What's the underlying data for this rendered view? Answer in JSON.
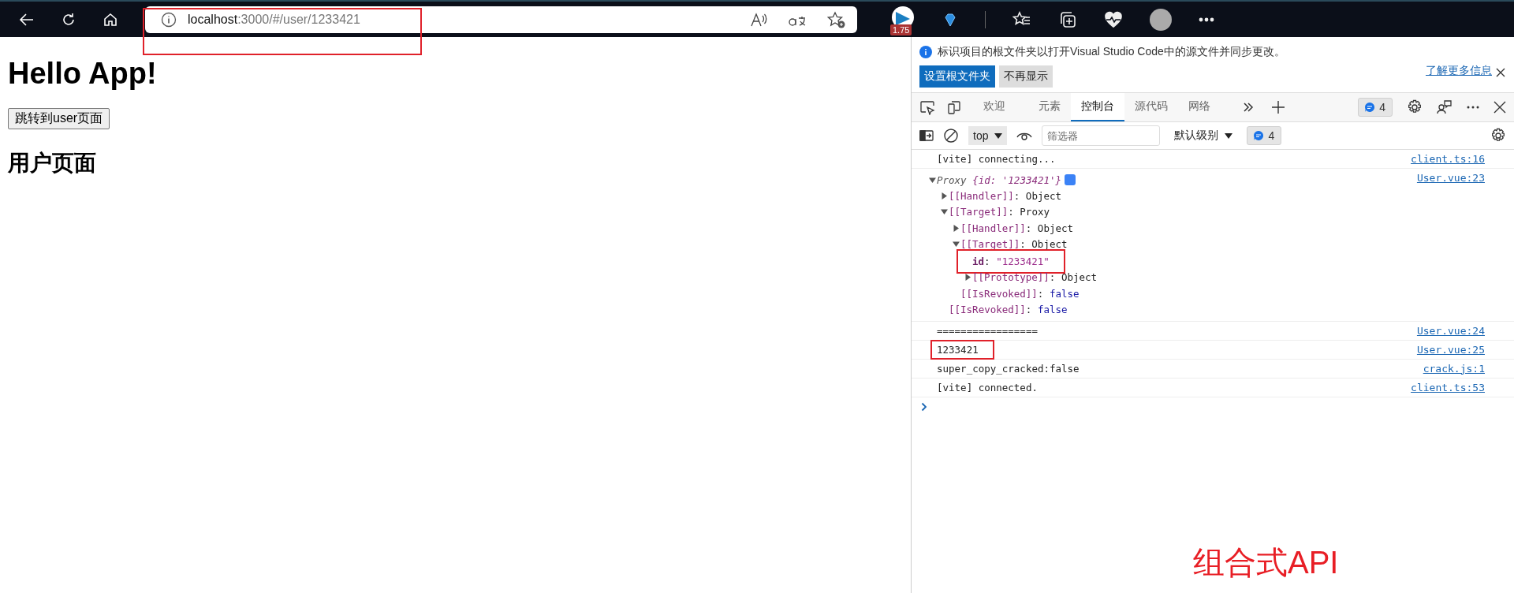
{
  "browser": {
    "url_host": "localhost",
    "url_rest": ":3000/#/user/1233421",
    "extension_badge": "1.75"
  },
  "page": {
    "title": "Hello App!",
    "button": "跳转到user页面",
    "subtitle": "用户页面"
  },
  "devtools": {
    "infobar": {
      "message": "标识项目的根文件夹以打开Visual Studio Code中的源文件并同步更改。",
      "primary_button": "设置根文件夹",
      "secondary_button": "不再显示",
      "link": "了解更多信息"
    },
    "tabs": [
      {
        "label": "欢迎",
        "selected": false
      },
      {
        "label": "元素",
        "selected": false
      },
      {
        "label": "控制台",
        "selected": true
      },
      {
        "label": "源代码",
        "selected": false
      },
      {
        "label": "网络",
        "selected": false
      }
    ],
    "issues_count": "4",
    "toolbar": {
      "context": "top",
      "filter_placeholder": "筛选器",
      "level": "默认级别",
      "message_count": "4"
    },
    "messages": [
      {
        "kind": "text",
        "text": "[vite] connecting...",
        "source": "client.ts:16",
        "highlighted": false
      },
      {
        "kind": "object",
        "preview_class": "Proxy",
        "preview_body": "{id: '1233421'}",
        "expanded": true,
        "source": "User.vue:23",
        "children": [
          {
            "kind": "group",
            "key": "[[Handler]]",
            "sep": ": ",
            "own": false,
            "value": "Object",
            "color": "#222222",
            "expanded": false,
            "highlighted": false
          },
          {
            "kind": "group",
            "key": "[[Target]]",
            "sep": ": ",
            "own": false,
            "value": "Proxy",
            "color": "#222222",
            "expanded": true,
            "highlighted": false,
            "children": [
              {
                "kind": "group",
                "key": "[[Handler]]",
                "sep": ": ",
                "own": false,
                "value": "Object",
                "color": "#222222",
                "expanded": false,
                "highlighted": false
              },
              {
                "kind": "group",
                "key": "[[Target]]",
                "sep": ": ",
                "own": false,
                "value": "Object",
                "color": "#222222",
                "expanded": true,
                "highlighted": false,
                "children": [
                  {
                    "kind": "leaf",
                    "key": "id",
                    "sep": ": ",
                    "own": true,
                    "value": "\"1233421\"",
                    "color": "#9c2d8c",
                    "highlighted": true
                  },
                  {
                    "kind": "group",
                    "key": "[[Prototype]]",
                    "sep": ": ",
                    "own": false,
                    "value": "Object",
                    "color": "#222222",
                    "expanded": false,
                    "highlighted": false
                  }
                ]
              },
              {
                "kind": "leaf",
                "key": "[[IsRevoked]]",
                "sep": ": ",
                "own": false,
                "value": "false",
                "color": "#1a1aa6",
                "highlighted": false
              }
            ]
          },
          {
            "kind": "leaf",
            "key": "[[IsRevoked]]",
            "sep": ": ",
            "own": false,
            "value": "false",
            "color": "#1a1aa6",
            "highlighted": false
          }
        ]
      },
      {
        "kind": "text",
        "text": "=================",
        "source": "User.vue:24",
        "highlighted": false
      },
      {
        "kind": "text",
        "text": "1233421",
        "source": "User.vue:25",
        "highlighted": true
      },
      {
        "kind": "text",
        "text": "super_copy_cracked:false",
        "source": "crack.js:1",
        "highlighted": false
      },
      {
        "kind": "text",
        "text": "[vite] connected.",
        "source": "client.ts:53",
        "highlighted": false
      }
    ]
  },
  "annotation": {
    "label": "组合式API"
  }
}
